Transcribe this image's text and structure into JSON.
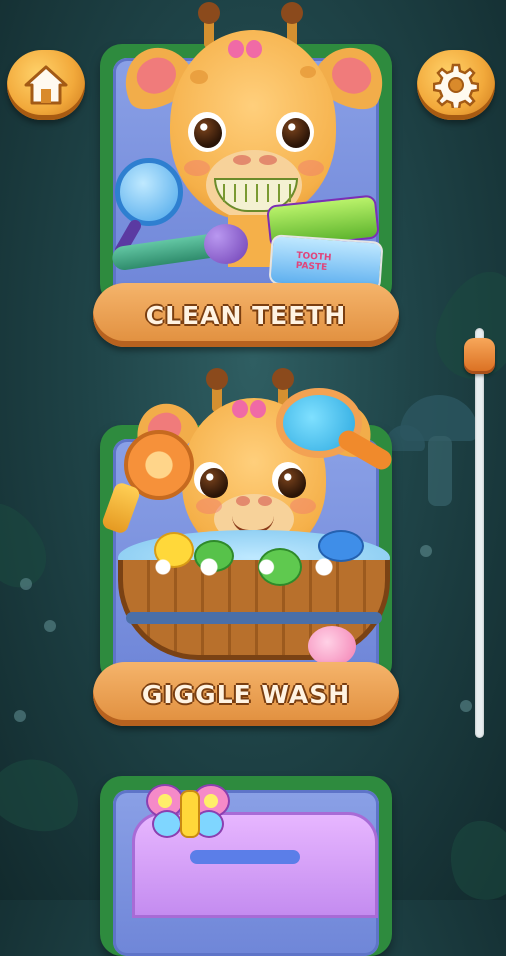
{
  "top_bar": {
    "home_icon": "home-icon",
    "settings_icon": "gear-icon"
  },
  "cards": [
    {
      "label": "CLEAN TEETH",
      "icon": "toothbrush-activity"
    },
    {
      "label": "GIGGLE WASH",
      "icon": "bath-activity"
    },
    {
      "label": "",
      "icon": "diaper-activity"
    }
  ],
  "toothpaste": {
    "line1": "TOOTH",
    "line2": "PASTE"
  },
  "scroll": {
    "position_fraction": 0.03
  },
  "colors": {
    "card_border": "#2e8b3e",
    "card_bg": "#7b90de",
    "label_pill": "#e08e3d",
    "button_gold": "#f2a93b"
  }
}
